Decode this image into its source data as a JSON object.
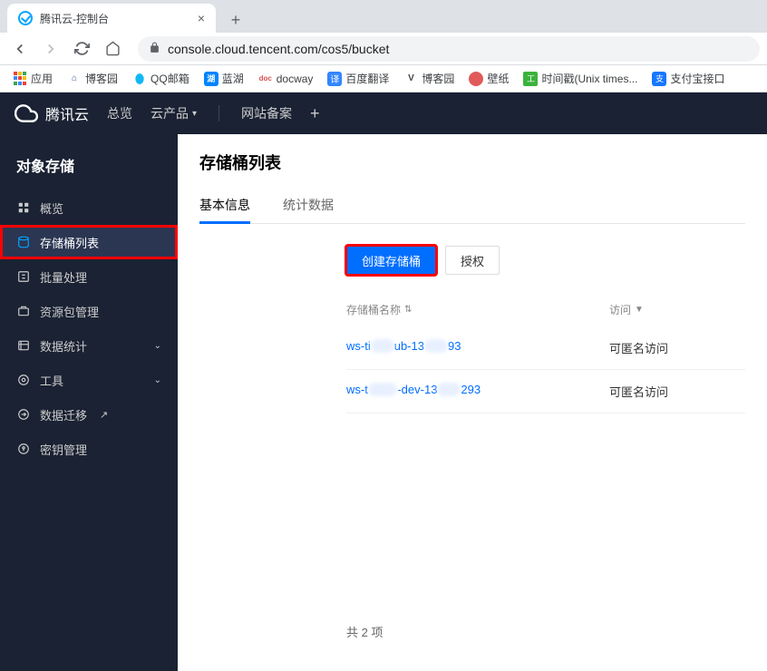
{
  "browser": {
    "tab_title": "腾讯云-控制台",
    "url": "console.cloud.tencent.com/cos5/bucket"
  },
  "bookmarks": [
    {
      "label": "应用",
      "icon": "apps",
      "color": "#5f6368"
    },
    {
      "label": "博客园",
      "icon": "house",
      "color": "#3b5998"
    },
    {
      "label": "QQ邮箱",
      "icon": "qq",
      "color": "#00a4e8"
    },
    {
      "label": "蓝湖",
      "icon": "lanhu",
      "color": "#0084ff"
    },
    {
      "label": "docway",
      "icon": "doc",
      "color": "#d9534f"
    },
    {
      "label": "百度翻译",
      "icon": "trans",
      "color": "#3385ff"
    },
    {
      "label": "博客园",
      "icon": "V",
      "color": "#444"
    },
    {
      "label": "壁纸",
      "icon": "circle",
      "color": "#e05a5a"
    },
    {
      "label": "时间戳(Unix times...",
      "icon": "ts",
      "color": "#3bb33b"
    },
    {
      "label": "支付宝接口",
      "icon": "ali",
      "color": "#1677ff"
    }
  ],
  "top_nav": {
    "brand": "腾讯云",
    "items": [
      "总览",
      "云产品"
    ],
    "right_item": "网站备案"
  },
  "sidebar": {
    "title": "对象存储",
    "items": [
      {
        "label": "概览",
        "icon": "grid",
        "active": false,
        "chevron": false
      },
      {
        "label": "存储桶列表",
        "icon": "bucket",
        "active": true,
        "highlighted": true,
        "chevron": false
      },
      {
        "label": "批量处理",
        "icon": "batch",
        "active": false,
        "chevron": false
      },
      {
        "label": "资源包管理",
        "icon": "package",
        "active": false,
        "chevron": false
      },
      {
        "label": "数据统计",
        "icon": "stats",
        "active": false,
        "chevron": true
      },
      {
        "label": "工具",
        "icon": "tool",
        "active": false,
        "chevron": true
      },
      {
        "label": "数据迁移",
        "icon": "migrate",
        "active": false,
        "chevron": false,
        "external": true
      },
      {
        "label": "密钥管理",
        "icon": "key",
        "active": false,
        "chevron": false
      }
    ]
  },
  "main": {
    "title": "存储桶列表",
    "tabs": [
      {
        "label": "基本信息",
        "active": true
      },
      {
        "label": "统计数据",
        "active": false
      }
    ],
    "actions": {
      "create": "创建存储桶",
      "authorize": "授权"
    },
    "columns": {
      "name": "存储桶名称",
      "access": "访问"
    },
    "rows": [
      {
        "name_prefix": "ws-ti",
        "name_mid": "xxxx",
        "name_suffix_a": "ub-13",
        "name_mid2": "xxxx",
        "name_end": "93",
        "access": "可匿名访问"
      },
      {
        "name_prefix": "ws-t",
        "name_mid": "xxxxx",
        "name_suffix_a": "-dev-13",
        "name_mid2": "xxxx",
        "name_end": "293",
        "access": "可匿名访问"
      }
    ],
    "footer": "共 2 项"
  }
}
